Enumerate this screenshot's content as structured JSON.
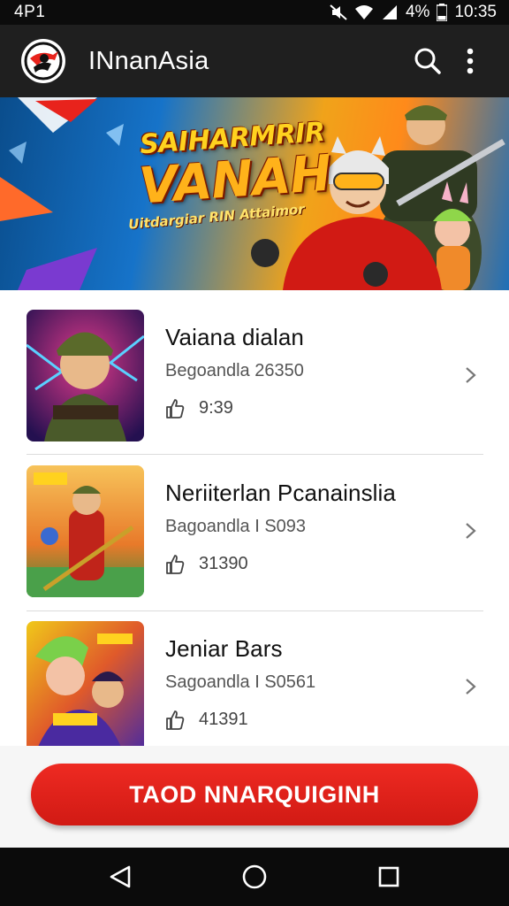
{
  "status_bar": {
    "carrier": "4P1",
    "battery": "4%",
    "time": "10:35"
  },
  "app_bar": {
    "title": "INnanAsia",
    "logo_icon": "app-logo-icon",
    "actions": [
      "search-icon",
      "more-vert-icon"
    ]
  },
  "banner": {
    "title_line1": "SAIHARMRIR",
    "title_line2": "VANAH",
    "subtitle": "Uitdargiar RIN Attaimor"
  },
  "games": [
    {
      "name": "Vaiana dialan",
      "meta": "Begoandla 26350",
      "count": "9:39",
      "thumb_colors": [
        "#3a1e6e",
        "#e03a8a"
      ]
    },
    {
      "name": "Neriiterlan Pcanainslia",
      "meta": "Bagoandla I S093",
      "count": "31390",
      "thumb_colors": [
        "#f08a2a",
        "#3aa04a"
      ]
    },
    {
      "name": "Jeniar Bars",
      "meta": "Sagoandla I S0561",
      "count": "41391",
      "thumb_colors": [
        "#f0c81a",
        "#4a2aa0"
      ]
    }
  ],
  "cta": {
    "label": "TAOD NNARQUIGINH"
  },
  "nav": [
    "back-icon",
    "home-icon",
    "recents-icon"
  ],
  "colors": {
    "accent": "#e8231c",
    "appbar": "#1f1f1f"
  }
}
